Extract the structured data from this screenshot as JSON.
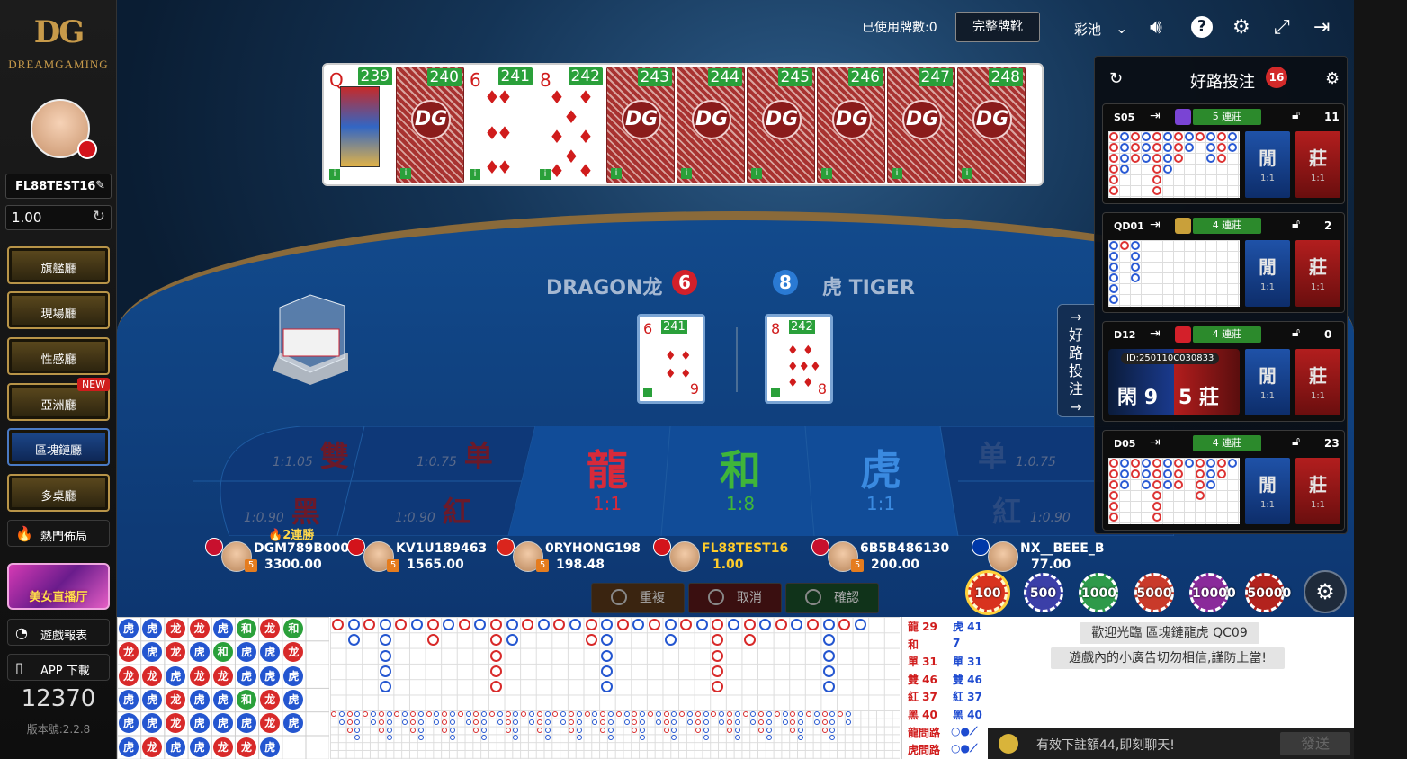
{
  "brand": {
    "logo_mark": "DG",
    "logo_text": "DREAMGAMING"
  },
  "user": {
    "username": "FL88TEST16",
    "balance": "1.00"
  },
  "nav": [
    {
      "label": "旗艦廳"
    },
    {
      "label": "現場廳"
    },
    {
      "label": "性感廳"
    },
    {
      "label": "亞洲廳",
      "badge": "NEW"
    },
    {
      "label": "區塊鏈廳",
      "active": true
    },
    {
      "label": "多桌廳"
    }
  ],
  "sidelinks": {
    "hot": "熱門佈局",
    "report": "遊戲報表",
    "app": "APP 下載"
  },
  "promo_label": "美女直播厅",
  "online_count": "12370",
  "version": "版本號:2.2.8",
  "topbar": {
    "used_cards": "已使用牌數:0",
    "full_shoe": "完整牌靴",
    "lottery": "彩池"
  },
  "cards": [
    {
      "num": "239",
      "face": "Q",
      "suit": "♦",
      "type": "queen"
    },
    {
      "num": "240",
      "type": "back"
    },
    {
      "num": "241",
      "face": "6",
      "suit": "♦",
      "type": "face"
    },
    {
      "num": "242",
      "face": "8",
      "suit": "♦",
      "type": "face"
    },
    {
      "num": "243",
      "type": "back"
    },
    {
      "num": "244",
      "type": "back"
    },
    {
      "num": "245",
      "type": "back"
    },
    {
      "num": "246",
      "type": "back"
    },
    {
      "num": "247",
      "type": "back"
    },
    {
      "num": "248",
      "type": "back"
    }
  ],
  "card_back_text": "DG",
  "round": {
    "dragon_label": "DRAGON龙",
    "dragon_score": "6",
    "tiger_label": "虎 TIGER",
    "tiger_score": "8",
    "dragon_card": {
      "num": "241",
      "rank": "6",
      "rank_bottom": "9"
    },
    "tiger_card": {
      "num": "242",
      "rank": "8",
      "rank_bottom": "8"
    }
  },
  "bets": {
    "even": {
      "label": "雙",
      "odds": "1:1.05"
    },
    "odd_l": {
      "label": "单",
      "odds": "1:0.75"
    },
    "black_l": {
      "label": "黑",
      "odds": "1:0.90"
    },
    "red_l": {
      "label": "紅",
      "odds": "1:0.90"
    },
    "dragon": {
      "label": "龍",
      "odds": "1:1"
    },
    "tie": {
      "label": "和",
      "odds": "1:8"
    },
    "tiger": {
      "label": "虎",
      "odds": "1:1"
    },
    "odd_r": {
      "label": "单",
      "odds": "1:0.75"
    },
    "red_r": {
      "label": "紅",
      "odds": "1:0.90"
    }
  },
  "streak_label": "2連勝",
  "players": [
    {
      "name": "DGM789B000",
      "balance": "3300.00",
      "flag": "#c8102e",
      "vip": "5"
    },
    {
      "name": "KV1U189463",
      "balance": "1565.00",
      "flag": "#d3131b",
      "vip": "5"
    },
    {
      "name": "0RYHONG198",
      "balance": "198.48",
      "flag": "#da251d",
      "vip": "5"
    },
    {
      "name": "FL88TEST16",
      "balance": "1.00",
      "flag": "#d3131b",
      "vip": ""
    },
    {
      "name": "6B5B486130",
      "balance": "200.00",
      "flag": "#c8102e",
      "vip": "5"
    },
    {
      "name": "NX__BEEE_B",
      "balance": "77.00",
      "flag": "#0038a8",
      "vip": ""
    }
  ],
  "actions": {
    "rebet": "重複",
    "cancel": "取消",
    "confirm": "確認"
  },
  "chips": [
    {
      "value": "100",
      "color": "#d8331e",
      "selected": true
    },
    {
      "value": "500",
      "color": "#3b3fa8"
    },
    {
      "value": "1000",
      "color": "#2e9a4a"
    },
    {
      "value": "5000",
      "color": "#c93a2a"
    },
    {
      "value": "10000",
      "color": "#8a2a9a"
    },
    {
      "value": "50000",
      "color": "#b3231e"
    }
  ],
  "goodroad": {
    "title": "好路投注",
    "badge": "16",
    "side_tab": "好路投注",
    "tables": [
      {
        "id": "S05",
        "streak": "5 連莊",
        "count": "11",
        "tagcolor": "#7a44d4",
        "mode": "road"
      },
      {
        "id": "QD01",
        "streak": "4 連莊",
        "count": "2",
        "tagcolor": "#c9a03a",
        "mode": "road"
      },
      {
        "id": "D12",
        "streak": "4 連莊",
        "count": "0",
        "tagcolor": "#d3202a",
        "mode": "result",
        "round_id": "ID:250110C030833",
        "player_label": "閑",
        "player_score": "9",
        "banker_score": "5",
        "banker_label": "莊"
      },
      {
        "id": "D05",
        "streak": "4 連莊",
        "count": "23",
        "tagcolor": "",
        "mode": "road"
      }
    ],
    "player_btn": "閒",
    "banker_btn": "莊",
    "odds": "1:1"
  },
  "bead_rows": [
    [
      "虎",
      "虎",
      "龙",
      "龙",
      "虎",
      "和",
      "龙",
      "和"
    ],
    [
      "龙",
      "虎",
      "龙",
      "虎",
      "和",
      "虎",
      "虎",
      "龙"
    ],
    [
      "龙",
      "龙",
      "虎",
      "龙",
      "龙",
      "虎",
      "虎",
      "虎"
    ],
    [
      "虎",
      "虎",
      "龙",
      "虎",
      "虎",
      "和",
      "龙",
      "虎"
    ],
    [
      "虎",
      "虎",
      "龙",
      "虎",
      "虎",
      "虎",
      "龙",
      "虎"
    ],
    [
      "虎",
      "龙",
      "虎",
      "虎",
      "龙",
      "龙",
      "虎",
      ""
    ]
  ],
  "stats": [
    {
      "l": "龍 29",
      "r": "虎 41"
    },
    {
      "l": "和",
      "r": "7"
    },
    {
      "l": "單 31",
      "r": "單 31"
    },
    {
      "l": "雙 46",
      "r": "雙 46"
    },
    {
      "l": "紅 37",
      "r": "紅 37"
    },
    {
      "l": "黑 40",
      "r": "黑 40"
    },
    {
      "l": "龍問路",
      "r": ""
    },
    {
      "l": "虎問路",
      "r": ""
    }
  ],
  "chat": {
    "welcome": "歡迎光臨 區塊鏈龍虎 QC09",
    "warning": "遊戲內的小廣告切勿相信,謹防上當!",
    "hint": "有效下註額44,即刻聊天!",
    "send": "發送"
  }
}
